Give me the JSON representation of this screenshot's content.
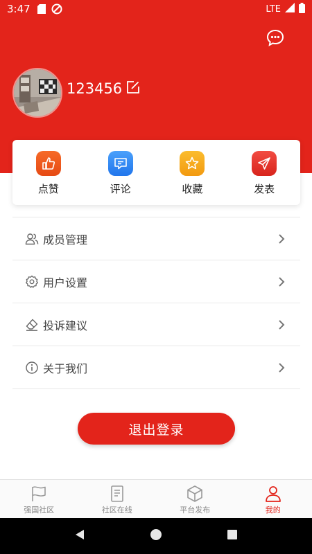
{
  "status_bar": {
    "time": "3:47",
    "network": "LTE"
  },
  "header": {
    "message_icon": "chat-bubble-icon"
  },
  "profile": {
    "username": "123456",
    "edit_icon": "edit-icon"
  },
  "actions": [
    {
      "label": "点赞",
      "icon": "thumbs-up-icon",
      "color": "#f0581e"
    },
    {
      "label": "评论",
      "icon": "comment-icon",
      "color": "#2f8af5"
    },
    {
      "label": "收藏",
      "icon": "star-icon",
      "color": "#f7a51a"
    },
    {
      "label": "发表",
      "icon": "paper-plane-icon",
      "color": "#e8342e"
    }
  ],
  "menu": [
    {
      "label": "成员管理",
      "icon": "members-icon"
    },
    {
      "label": "用户设置",
      "icon": "gear-icon"
    },
    {
      "label": "投诉建议",
      "icon": "eraser-icon"
    },
    {
      "label": "关于我们",
      "icon": "info-icon"
    }
  ],
  "logout_label": "退出登录",
  "tabs": [
    {
      "label": "强国社区",
      "icon": "flag-icon",
      "active": false
    },
    {
      "label": "社区在线",
      "icon": "document-icon",
      "active": false
    },
    {
      "label": "平台发布",
      "icon": "cube-icon",
      "active": false
    },
    {
      "label": "我的",
      "icon": "user-icon",
      "active": true
    }
  ],
  "colors": {
    "primary": "#e3241b",
    "inactive_tab": "#888888"
  }
}
